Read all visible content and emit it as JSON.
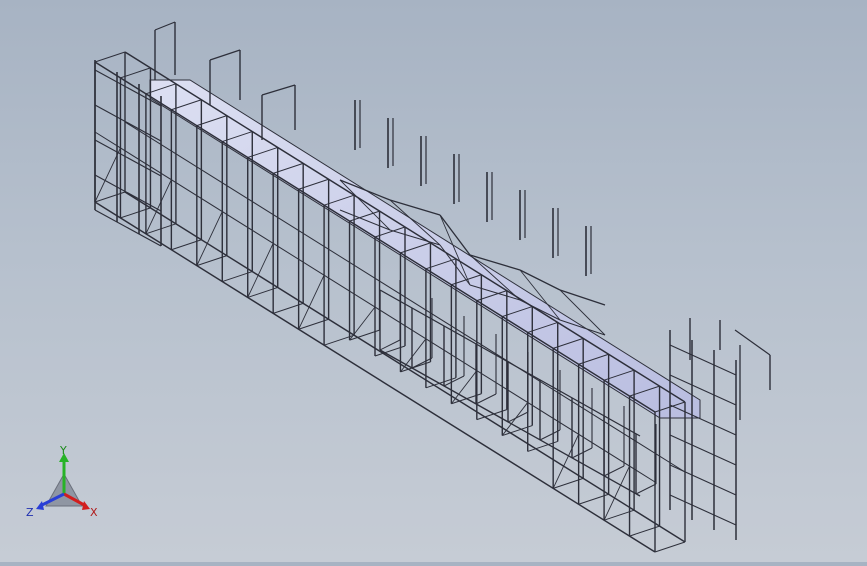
{
  "viewport": {
    "background_top": "#a7b3c3",
    "background_bottom": "#c6ccd5",
    "model_stroke": "#2d2f3a",
    "model_face": "#c9cce4"
  },
  "triad": {
    "x_label": "X",
    "y_label": "Y",
    "z_label": "Z",
    "x_color": "#d21e1e",
    "y_color": "#27b327",
    "z_color": "#2a3fd6"
  }
}
